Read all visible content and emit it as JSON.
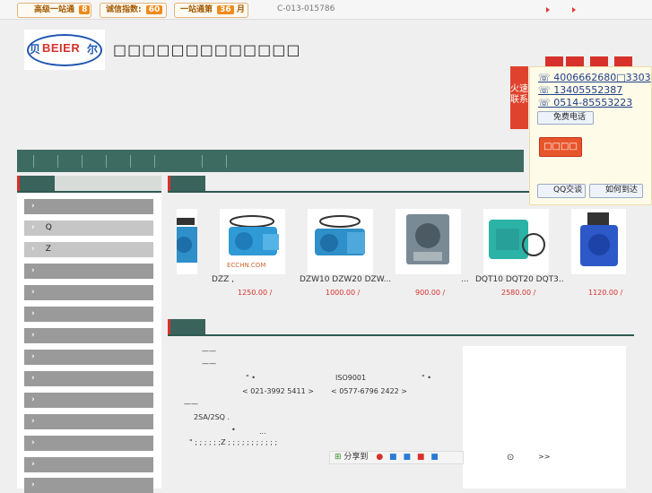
{
  "topbar": {
    "badge1_label": "高级一站通",
    "badge1_num": "8",
    "badge2_label": "诚信指数:",
    "badge2_num": "60",
    "badge3_label": "一站通第",
    "badge3_num": "36",
    "badge3_unit": "月",
    "phone": "C-013-015786"
  },
  "header": {
    "logo_text": "BEIER",
    "logo_left": "贝",
    "logo_right": "尔",
    "company_name": "□□□□□□□□□□□□□"
  },
  "contact": {
    "tab_label": "火速联系",
    "phones": [
      "4006662680□3303",
      "13405552387",
      "0514-85553223"
    ],
    "free_call": "免费电话",
    "red_button": "□□□□",
    "qq_chat": "QQ交谈",
    "directions": "如何到达"
  },
  "sidebar": {
    "items": [
      {
        "arrow": "›",
        "label": ""
      },
      {
        "arrow": "›",
        "label": "Q"
      },
      {
        "arrow": "›",
        "label": "Z"
      },
      {
        "arrow": "›",
        "label": ""
      },
      {
        "arrow": "›",
        "label": ""
      },
      {
        "arrow": "›",
        "label": ""
      },
      {
        "arrow": "›",
        "label": ""
      },
      {
        "arrow": "›",
        "label": ""
      },
      {
        "arrow": "›",
        "label": ""
      },
      {
        "arrow": "›",
        "label": ""
      },
      {
        "arrow": "›",
        "label": ""
      },
      {
        "arrow": "›",
        "label": ""
      },
      {
        "arrow": "›",
        "label": ""
      },
      {
        "arrow": "›",
        "label": ""
      }
    ]
  },
  "products": [
    {
      "label": "DZZ ,",
      "price": "1250.00 /"
    },
    {
      "label": "DZW10 DZW20 DZW...",
      "price": "1000.00 /"
    },
    {
      "label": "...",
      "price": "900.00 /"
    },
    {
      "label": "DQT10 DQT20 DQT3..",
      "price": "2580.00 /"
    },
    {
      "label": "",
      "price": "1120.00 /"
    }
  ],
  "about": {
    "line1": "——",
    "line2": "——",
    "line3a": "\" •",
    "line3b": "ISO9001",
    "line3c": "\" •",
    "phone1": "< 021-3992 5411 >",
    "phone2": "< 0577-6796 2422 >",
    "line5": "——",
    "line6": "2SA/2SQ .",
    "line7": "•",
    "line7b": "...",
    "line8": "\"  ;  ;  ;  ;  ;  ;Z  ;  ;  ;  ;  ;  ;  ;  ;  ;  ;  ;"
  },
  "share": {
    "label": "分享到",
    "more": ">>"
  }
}
